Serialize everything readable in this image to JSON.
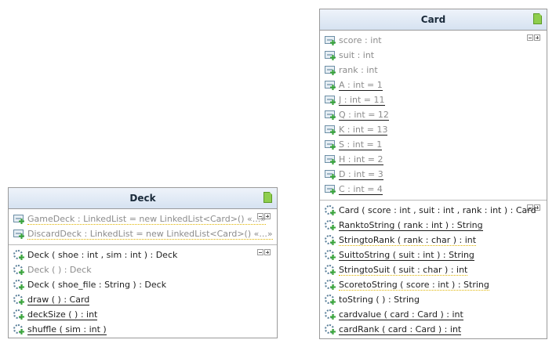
{
  "card": {
    "title": "Card",
    "attributes": [
      {
        "text": "score : int",
        "gray": true,
        "underline": false
      },
      {
        "text": "suit : int",
        "gray": true,
        "underline": false
      },
      {
        "text": "rank : int",
        "gray": true,
        "underline": false
      },
      {
        "text": "A : int = 1",
        "gray": true,
        "underline": true
      },
      {
        "text": "J : int = 11",
        "gray": true,
        "underline": true
      },
      {
        "text": "Q : int = 12",
        "gray": true,
        "underline": true
      },
      {
        "text": "K : int = 13",
        "gray": true,
        "underline": true
      },
      {
        "text": "S : int = 1",
        "gray": true,
        "underline": true
      },
      {
        "text": "H : int = 2",
        "gray": true,
        "underline": true
      },
      {
        "text": "D : int = 3",
        "gray": true,
        "underline": true
      },
      {
        "text": "C : int = 4",
        "gray": true,
        "underline": true
      }
    ],
    "methods": [
      {
        "text": "Card ( score : int , suit : int , rank : int ) : Card",
        "gray": false,
        "underline": false,
        "squiggle": false
      },
      {
        "text": "RanktoString ( rank : int ) : String",
        "gray": false,
        "underline": true,
        "squiggle": false
      },
      {
        "text": "StringtoRank ( rank : char ) : int",
        "gray": false,
        "underline": true,
        "squiggle": true
      },
      {
        "text": "SuittoString ( suit : int ) : String",
        "gray": false,
        "underline": true,
        "squiggle": false
      },
      {
        "text": "StringtoSuit ( suit : char ) : int",
        "gray": false,
        "underline": true,
        "squiggle": true
      },
      {
        "text": "ScoretoString ( score : int ) : String",
        "gray": false,
        "underline": true,
        "squiggle": true
      },
      {
        "text": "toString ( ) : String",
        "gray": false,
        "underline": false,
        "squiggle": false
      },
      {
        "text": "cardvalue ( card : Card ) : int",
        "gray": false,
        "underline": true,
        "squiggle": false
      },
      {
        "text": "cardRank ( card : Card ) : int",
        "gray": false,
        "underline": true,
        "squiggle": false
      }
    ]
  },
  "deck": {
    "title": "Deck",
    "attributes": [
      {
        "text": "GameDeck : LinkedList = new LinkedList<Card>() «...»",
        "gray": true,
        "underline": true,
        "squiggle": true
      },
      {
        "text": "DiscardDeck : LinkedList = new LinkedList<Card>() «...»",
        "gray": true,
        "underline": true,
        "squiggle": true
      }
    ],
    "methods": [
      {
        "text": "Deck ( shoe : int , sim : int ) : Deck",
        "gray": false,
        "underline": false,
        "squiggle": false
      },
      {
        "text": "Deck ( ) : Deck",
        "gray": true,
        "underline": false,
        "squiggle": false
      },
      {
        "text": "Deck ( shoe_file : String ) : Deck",
        "gray": false,
        "underline": false,
        "squiggle": false
      },
      {
        "text": "draw ( ) : Card",
        "gray": false,
        "underline": true,
        "squiggle": false
      },
      {
        "text": "deckSize ( ) : int",
        "gray": false,
        "underline": true,
        "squiggle": false
      },
      {
        "text": "shuffle ( sim : int )",
        "gray": false,
        "underline": true,
        "squiggle": false
      }
    ]
  },
  "colors": {
    "header_top": "#eef3fa",
    "header_bottom": "#d6e2f1",
    "border": "#9a9a9a",
    "squiggle": "#e0b400"
  },
  "icons": {
    "attribute": "field-icon",
    "method": "method-icon",
    "class": "class-file-icon",
    "collapse": "collapse-icon",
    "expand": "expand-icon"
  }
}
